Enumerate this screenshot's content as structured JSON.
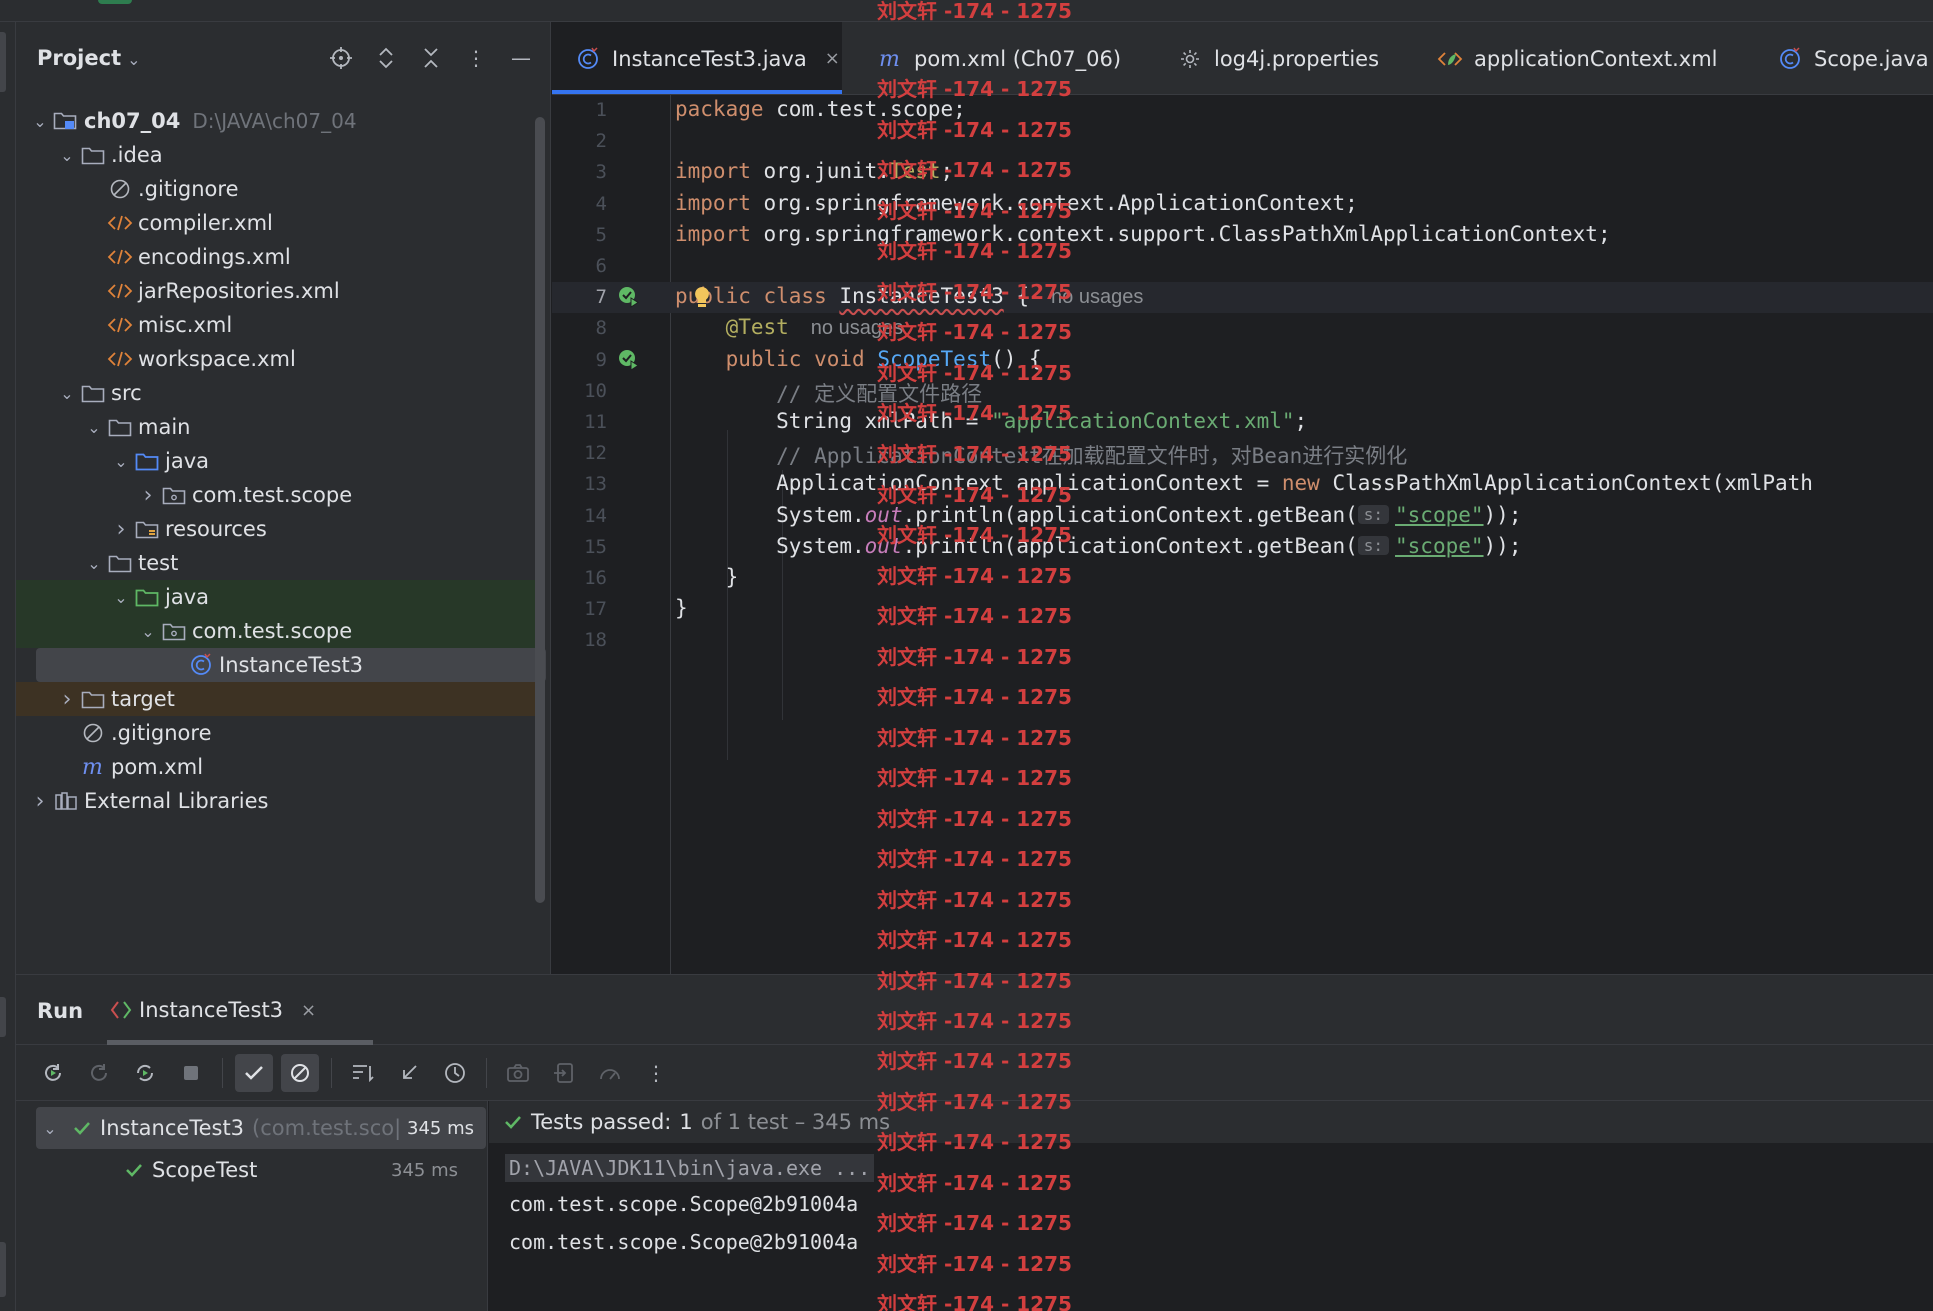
{
  "project_panel": {
    "title": "Project",
    "tree": [
      {
        "label": "ch07_04",
        "note": "D:\\JAVA\\ch07_04",
        "icon": "module-folder-icon",
        "twisty": "open",
        "bold": true
      },
      {
        "label": ".idea",
        "icon": "folder-icon",
        "twisty": "open"
      },
      {
        "label": ".gitignore",
        "icon": "ignored-file-icon"
      },
      {
        "label": "compiler.xml",
        "icon": "xml-file-icon"
      },
      {
        "label": "encodings.xml",
        "icon": "xml-file-icon"
      },
      {
        "label": "jarRepositories.xml",
        "icon": "xml-file-icon"
      },
      {
        "label": "misc.xml",
        "icon": "xml-file-icon"
      },
      {
        "label": "workspace.xml",
        "icon": "xml-file-icon"
      },
      {
        "label": "src",
        "icon": "folder-icon",
        "twisty": "open"
      },
      {
        "label": "main",
        "icon": "folder-icon",
        "twisty": "open"
      },
      {
        "label": "java",
        "icon": "source-folder-icon",
        "twisty": "open"
      },
      {
        "label": "com.test.scope",
        "icon": "package-icon",
        "twisty": "closed"
      },
      {
        "label": "resources",
        "icon": "resources-folder-icon",
        "twisty": "closed"
      },
      {
        "label": "test",
        "icon": "folder-icon",
        "twisty": "open"
      },
      {
        "label": "java",
        "icon": "test-folder-icon",
        "twisty": "open"
      },
      {
        "label": "com.test.scope",
        "icon": "package-icon",
        "twisty": "open"
      },
      {
        "label": "InstanceTest3",
        "icon": "java-class-icon"
      },
      {
        "label": "target",
        "icon": "folder-icon",
        "twisty": "closed"
      },
      {
        "label": ".gitignore",
        "icon": "ignored-file-icon"
      },
      {
        "label": "pom.xml",
        "icon": "maven-icon"
      },
      {
        "label": "External Libraries",
        "icon": "library-icon",
        "twisty": "closed"
      }
    ]
  },
  "tabs": [
    {
      "label": "InstanceTest3.java",
      "icon": "java-class-icon",
      "active": true,
      "close": "×"
    },
    {
      "label": "pom.xml (Ch07_06)",
      "icon": "maven-icon"
    },
    {
      "label": "log4j.properties",
      "icon": "gear-icon"
    },
    {
      "label": "applicationContext.xml",
      "icon": "spring-xml-icon"
    },
    {
      "label": "Scope.java",
      "icon": "java-class-icon"
    }
  ],
  "editor": {
    "line_numbers": [
      "1",
      "2",
      "3",
      "4",
      "5",
      "6",
      "7",
      "8",
      "9",
      "10",
      "11",
      "12",
      "13",
      "14",
      "15",
      "16",
      "17",
      "18"
    ],
    "current_line": "7",
    "code": {
      "l1_kw": "package",
      "l1_rest": " com.test.scope;",
      "l3_kw": "import",
      "l3_pre": " org.junit.",
      "l3_ann": "Test",
      "l3_post": ";",
      "l4_kw": "import",
      "l4_rest": " org.springframework.context.ApplicationContext;",
      "l5_kw": "import",
      "l5_rest": " org.springframework.context.support.ClassPathXmlApplicationContext;",
      "l7_kw": "public class",
      "l7_cls": "InstanceTest3",
      "l7_brace": " {",
      "l7_hint": "no usages",
      "l8_ann": "@Test",
      "l8_hint": "no usages",
      "l9_kw": "public void",
      "l9_fn": "ScopeTest",
      "l9_rest": "() {",
      "l10_cm": "// 定义配置文件路径",
      "l11_pre": "String xmlPath = ",
      "l11_str": "\"applicationContext.xml\"",
      "l11_post": ";",
      "l12_cm": "// ApplicationContext在加载配置文件时，对Bean进行实例化",
      "l13_pre": "ApplicationContext applicationContext = ",
      "l13_kw": "new",
      "l13_rest": " ClassPathXmlApplicationContext(xmlPath",
      "l14_pre": "System.",
      "l14_field": "out",
      "l14_mid": ".println(applicationContext.getBean(",
      "l14_param": "s:",
      "l14_str": "\"scope\"",
      "l14_post": "));",
      "l15_pre": "System.",
      "l15_field": "out",
      "l15_mid": ".println(applicationContext.getBean(",
      "l15_param": "s:",
      "l15_str": "\"scope\"",
      "l15_post": "));",
      "l16": "}",
      "l17": "}"
    }
  },
  "watermark": {
    "text": "刘文轩 -174 - 1275",
    "color": "#d33f3f"
  },
  "run_panel": {
    "title": "Run",
    "tab_label": "InstanceTest3",
    "tab_close": "×",
    "test_tree": [
      {
        "name": "InstanceTest3",
        "detail": "(com.test.sco|",
        "time": "345 ms",
        "status": "passed"
      },
      {
        "name": "ScopeTest",
        "time": "345 ms",
        "status": "passed"
      }
    ],
    "summary_prefix": "Tests passed:",
    "summary_count": "1",
    "summary_rest": "of 1 test – 345 ms",
    "console": [
      "D:\\JAVA\\JDK11\\bin\\java.exe ...",
      "com.test.scope.Scope@2b91004a",
      "com.test.scope.Scope@2b91004a"
    ]
  },
  "colors": {
    "accent": "#3574f0",
    "pass": "#5fb865",
    "keyword": "#cf8e6d",
    "string": "#6aab73"
  }
}
